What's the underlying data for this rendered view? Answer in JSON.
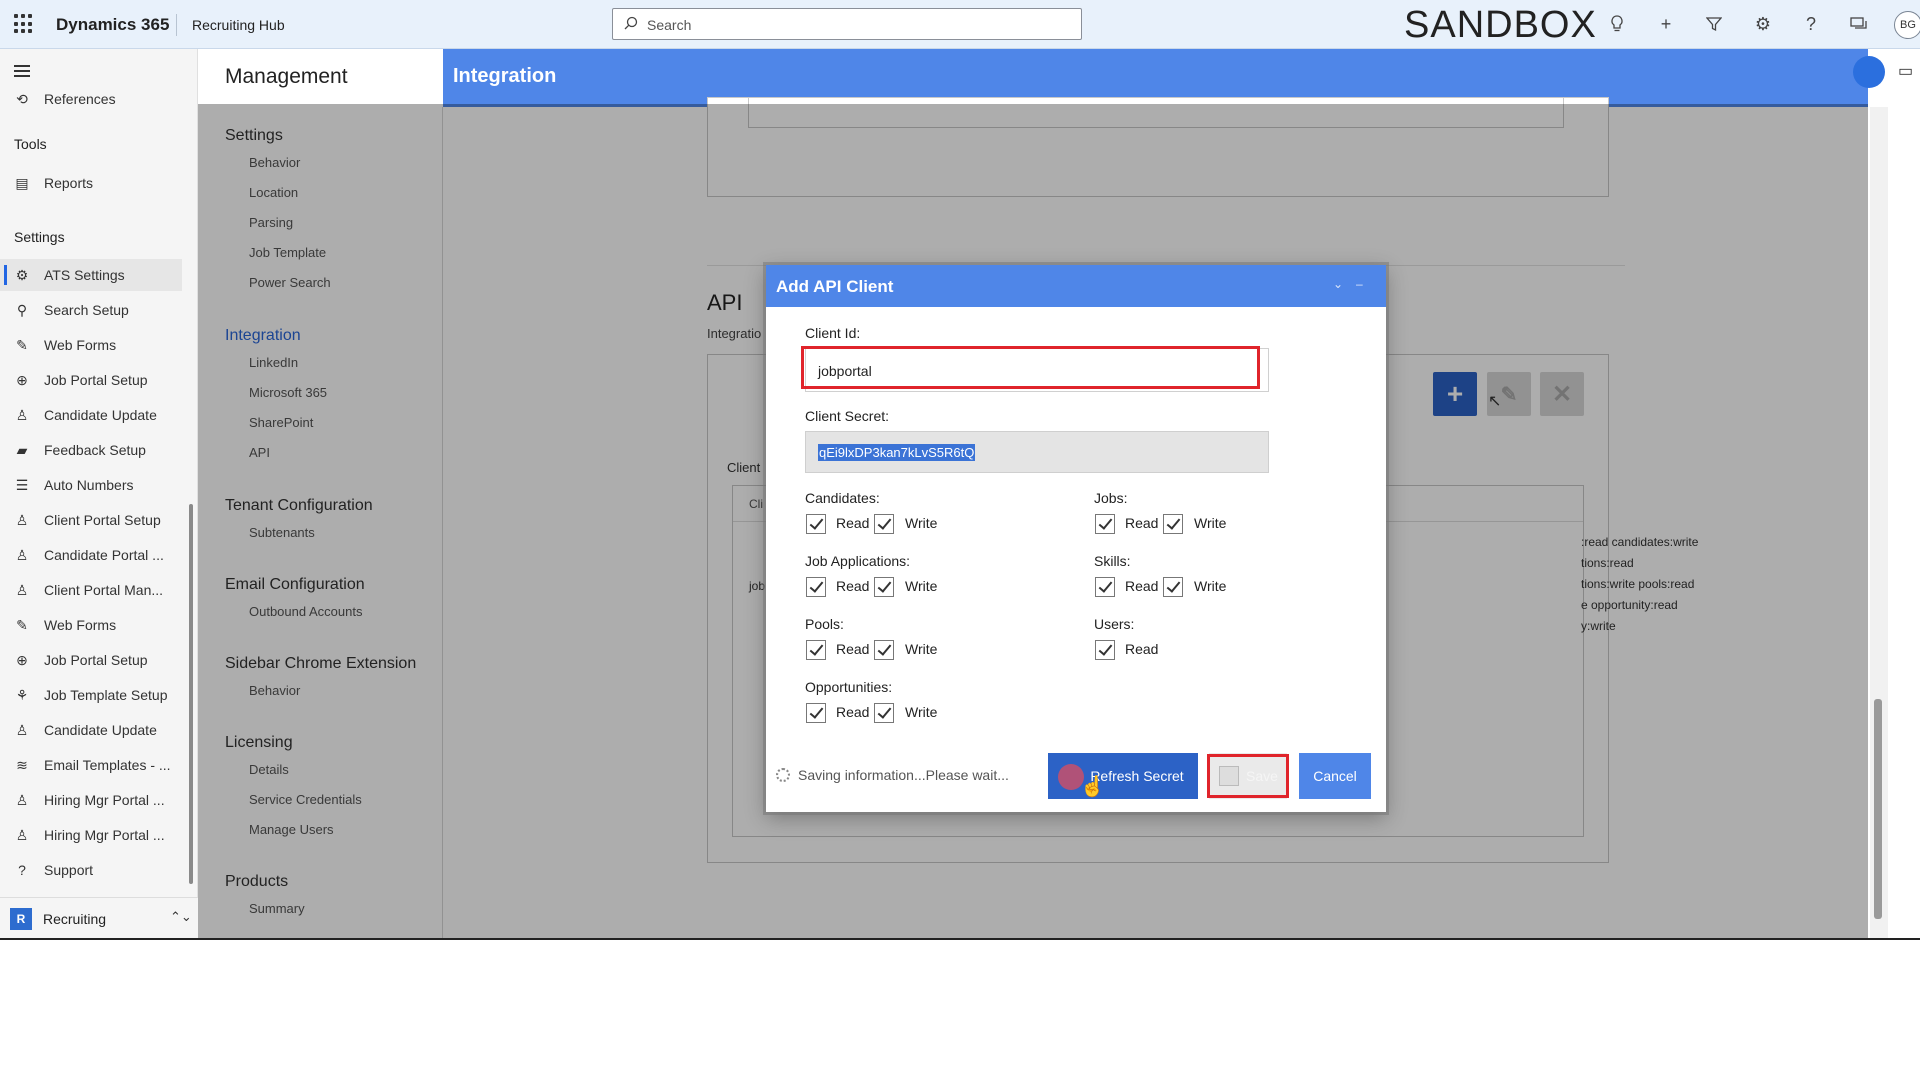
{
  "topbar": {
    "brand": "Dynamics 365",
    "app_title": "Recruiting Hub",
    "search_placeholder": "Search",
    "environment": "SANDBOX",
    "avatar_initials": "BG",
    "icons": [
      "lightbulb-icon",
      "plus-icon",
      "filter-icon",
      "gear-icon",
      "help-icon",
      "chat-icon"
    ]
  },
  "leftnav": {
    "cut_item": "References",
    "groups": [
      {
        "header": "Tools",
        "items": [
          {
            "label": "Reports",
            "icon": "report-icon"
          }
        ]
      },
      {
        "header": "Settings",
        "items": [
          {
            "label": "ATS Settings",
            "icon": "gear-icon",
            "active": true
          },
          {
            "label": "Search Setup",
            "icon": "search-setup-icon"
          },
          {
            "label": "Web Forms",
            "icon": "form-icon"
          },
          {
            "label": "Job Portal Setup",
            "icon": "globe-icon"
          },
          {
            "label": "Candidate Update",
            "icon": "person-icon"
          },
          {
            "label": "Feedback Setup",
            "icon": "feedback-icon"
          },
          {
            "label": "Auto Numbers",
            "icon": "list-icon"
          },
          {
            "label": "Client Portal Setup",
            "icon": "person-icon"
          },
          {
            "label": "Candidate Portal ...",
            "icon": "people-icon"
          },
          {
            "label": "Client Portal Man...",
            "icon": "person-icon"
          },
          {
            "label": "Web Forms",
            "icon": "form-icon"
          },
          {
            "label": "Job Portal Setup",
            "icon": "globe-icon"
          },
          {
            "label": "Job Template Setup",
            "icon": "template-icon"
          },
          {
            "label": "Candidate Update",
            "icon": "people-icon"
          },
          {
            "label": "Email Templates - ...",
            "icon": "stack-icon"
          },
          {
            "label": "Hiring Mgr Portal ...",
            "icon": "people-icon"
          },
          {
            "label": "Hiring Mgr Portal ...",
            "icon": "person-icon"
          },
          {
            "label": "Support",
            "icon": "help-icon"
          }
        ]
      }
    ],
    "area": {
      "badge": "R",
      "label": "Recruiting"
    }
  },
  "management": {
    "title": "Management",
    "sections": [
      {
        "title": "Settings",
        "items": [
          "Behavior",
          "Location",
          "Parsing",
          "Job Template",
          "Power Search"
        ]
      },
      {
        "title": "Integration",
        "active": true,
        "items": [
          "LinkedIn",
          "Microsoft 365",
          "SharePoint",
          "API"
        ]
      },
      {
        "title": "Tenant Configuration",
        "items": [
          "Subtenants"
        ]
      },
      {
        "title": "Email Configuration",
        "items": [
          "Outbound Accounts"
        ]
      },
      {
        "title": "Sidebar Chrome Extension",
        "items": [
          "Behavior"
        ]
      },
      {
        "title": "Licensing",
        "items": [
          "Details",
          "Service Credentials",
          "Manage Users"
        ]
      },
      {
        "title": "Products",
        "items": [
          "Summary"
        ]
      }
    ]
  },
  "page": {
    "title": "Integration",
    "api_title": "API",
    "api_subtitle": "Integratio",
    "clients_label": "Client",
    "table_header_cut": "Cli",
    "row_cut": "job",
    "scopes_visible": [
      ":read candidates:write",
      "tions:read",
      "tions:write pools:read",
      "e opportunity:read",
      "y:write"
    ]
  },
  "dialog": {
    "title": "Add API Client",
    "client_id_label": "Client Id:",
    "client_id_value": "jobportal",
    "client_secret_label": "Client Secret:",
    "client_secret_value": "qEi9lxDP3kan7kLvS5R6tQ",
    "read_label": "Read",
    "write_label": "Write",
    "permissions": [
      {
        "group": "Candidates:",
        "read": true,
        "write": true
      },
      {
        "group": "Jobs:",
        "read": true,
        "write": true
      },
      {
        "group": "Job Applications:",
        "read": true,
        "write": true
      },
      {
        "group": "Skills:",
        "read": true,
        "write": true
      },
      {
        "group": "Pools:",
        "read": true,
        "write": true
      },
      {
        "group": "Users:",
        "read": true
      },
      {
        "group": "Opportunities:",
        "read": true,
        "write": true
      }
    ],
    "status": "Saving information...Please wait...",
    "refresh_label": "Refresh Secret",
    "save_label": "Save",
    "cancel_label": "Cancel"
  },
  "colors": {
    "accent": "#4f86e8",
    "highlight": "#e0242b",
    "primary_button": "#2c62c6"
  }
}
